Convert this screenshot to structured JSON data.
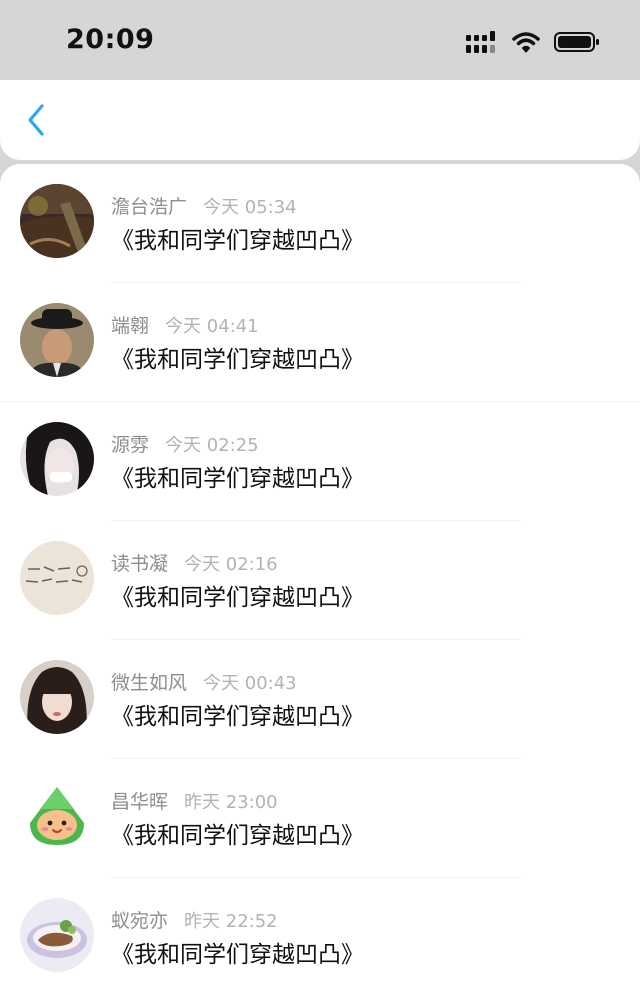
{
  "status_bar": {
    "time": "20:09",
    "icons": [
      "signal-icon",
      "wifi-icon",
      "battery-icon"
    ]
  },
  "header": {
    "back_icon": "chevron-left-icon",
    "accent_color": "#2aa7f0"
  },
  "items": [
    {
      "username": "澹台浩广",
      "time": "今天 05:34",
      "message": "《我和同学们穿越凹凸》",
      "avatar": "avatar-landscape-icon"
    },
    {
      "username": "端翱",
      "time": "今天 04:41",
      "message": "《我和同学们穿越凹凸》",
      "avatar": "avatar-man-hat-icon"
    },
    {
      "username": "源雰",
      "time": "今天 02:25",
      "message": "《我和同学们穿越凹凸》",
      "avatar": "avatar-girl-dark-hair-icon"
    },
    {
      "username": "读书凝",
      "time": "今天 02:16",
      "message": "《我和同学们穿越凹凸》",
      "avatar": "avatar-handwriting-icon"
    },
    {
      "username": "微生如风",
      "time": "今天 00:43",
      "message": "《我和同学们穿越凹凸》",
      "avatar": "avatar-girl-portrait-icon"
    },
    {
      "username": "昌华晖",
      "time": "昨天 23:00",
      "message": "《我和同学们穿越凹凸》",
      "avatar": "avatar-zongzi-cartoon-icon"
    },
    {
      "username": "蚁宛亦",
      "time": "昨天 22:52",
      "message": "《我和同学们穿越凹凸》",
      "avatar": "avatar-food-plate-icon"
    }
  ]
}
